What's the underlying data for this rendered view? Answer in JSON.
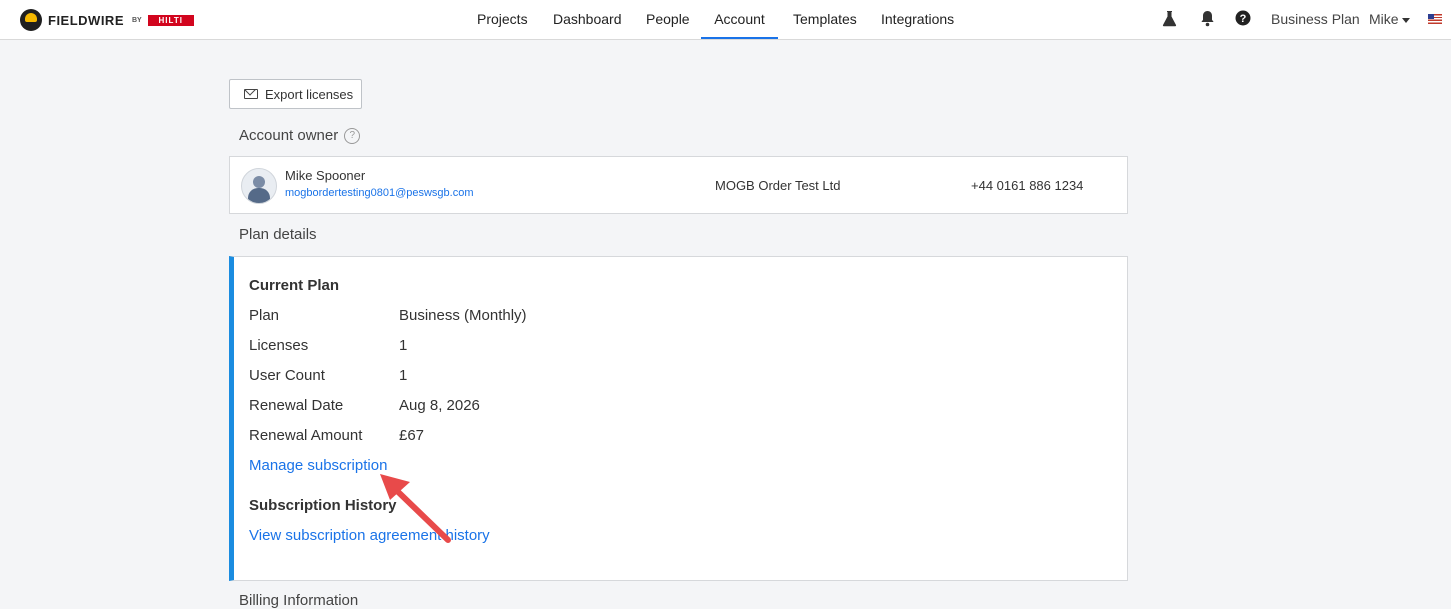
{
  "header": {
    "brand": "FIELDWIRE",
    "brand_by": "BY",
    "brand_partner": "HILTI",
    "nav": [
      "Projects",
      "Dashboard",
      "People",
      "Account",
      "Templates",
      "Integrations"
    ],
    "active_nav": "Account",
    "plan_label": "Business Plan",
    "user_label": "Mike",
    "icons": [
      "flask-icon",
      "bell-icon",
      "help-icon",
      "us-flag-icon"
    ]
  },
  "actions": {
    "export_label": "Export licenses"
  },
  "owner": {
    "section_title": "Account owner",
    "name": "Mike Spooner",
    "email": "mogbordertesting0801@peswsgb.com",
    "company": "MOGB Order Test Ltd",
    "phone": "+44 0161 886 1234"
  },
  "plan": {
    "section_title": "Plan details",
    "current_heading": "Current Plan",
    "rows": [
      {
        "label": "Plan",
        "value": "Business (Monthly)"
      },
      {
        "label": "Licenses",
        "value": "1"
      },
      {
        "label": "User Count",
        "value": "1"
      },
      {
        "label": "Renewal Date",
        "value": "Aug 8, 2026"
      },
      {
        "label": "Renewal Amount",
        "value": "£67"
      }
    ],
    "manage_link": "Manage subscription",
    "history_heading": "Subscription History",
    "history_link": "View subscription agreement history"
  },
  "billing": {
    "section_title": "Billing Information"
  },
  "colors": {
    "accent": "#1a73e8",
    "plan_border": "#1a8ce0",
    "arrow": "#e84a4a"
  }
}
